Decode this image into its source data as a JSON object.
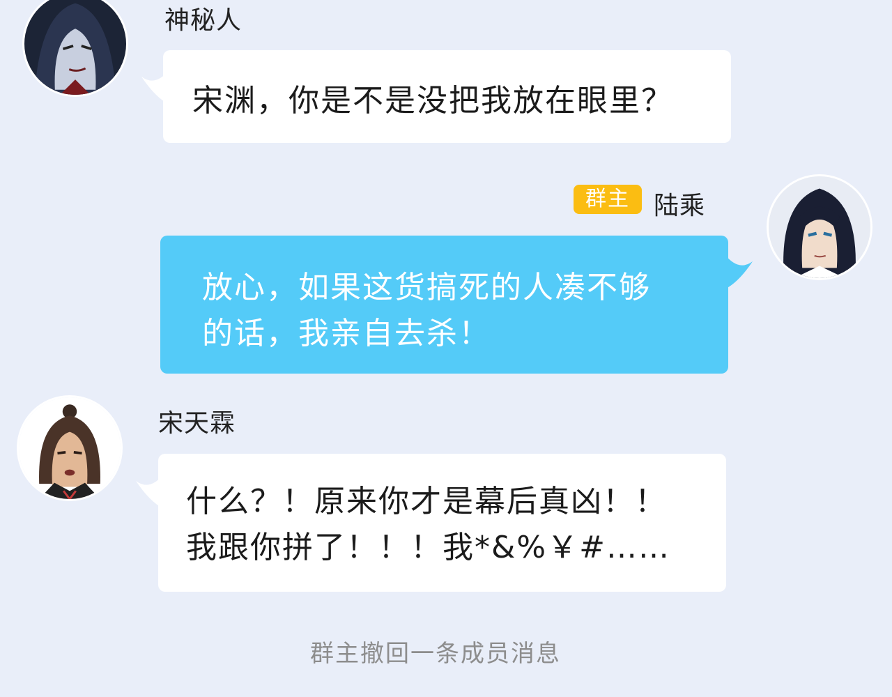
{
  "messages": [
    {
      "sender": "神秘人",
      "side": "left",
      "lines": [
        "宋渊，你是不是没把我放在眼里？"
      ]
    },
    {
      "sender": "陆乘",
      "side": "right",
      "badge": "群主",
      "lines": [
        "放心，如果这货搞死的人凑不够",
        "的话，我亲自去杀！"
      ]
    },
    {
      "sender": "宋天霖",
      "side": "left",
      "lines": [
        "什么？！原来你才是幕后真凶！！",
        "我跟你拼了！！！我*&%￥#……"
      ]
    }
  ],
  "system_notice": "群主撤回一条成员消息",
  "colors": {
    "background": "#e9eef9",
    "bubble_left": "#ffffff",
    "bubble_right": "#54cbf8",
    "badge": "#fbbd12"
  },
  "icons": {
    "avatar_1": "hooded-man-avatar-icon",
    "avatar_2": "long-haired-swordsman-avatar-icon",
    "avatar_3": "young-man-topknot-avatar-icon"
  }
}
